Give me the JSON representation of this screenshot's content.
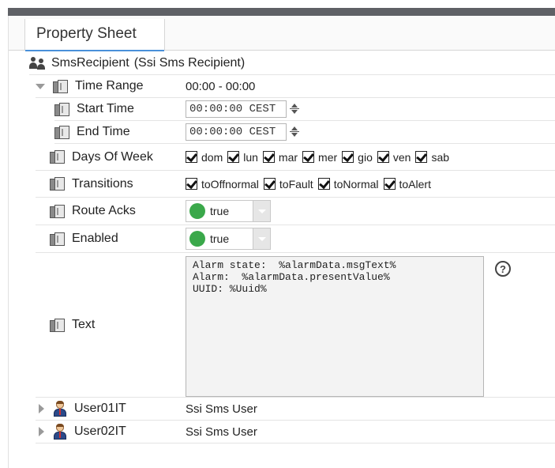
{
  "tab": {
    "label": "Property Sheet"
  },
  "root": {
    "name": "SmsRecipient",
    "type": "(Ssi Sms Recipient)"
  },
  "time_range": {
    "label": "Time Range",
    "value": "00:00 - 00:00",
    "start": {
      "label": "Start Time",
      "value": "00:00:00 CEST"
    },
    "end": {
      "label": "End Time",
      "value": "00:00:00 CEST"
    }
  },
  "days_of_week": {
    "label": "Days Of Week",
    "days": [
      "dom",
      "lun",
      "mar",
      "mer",
      "gio",
      "ven",
      "sab"
    ],
    "checked": [
      true,
      true,
      true,
      true,
      true,
      true,
      true
    ]
  },
  "transitions": {
    "label": "Transitions",
    "options": [
      "toOffnormal",
      "toFault",
      "toNormal",
      "toAlert"
    ],
    "checked": [
      true,
      true,
      true,
      true
    ]
  },
  "route_acks": {
    "label": "Route Acks",
    "value": "true",
    "status_color": "#3aa84a"
  },
  "enabled": {
    "label": "Enabled",
    "value": "true",
    "status_color": "#3aa84a"
  },
  "text": {
    "label": "Text",
    "value": "Alarm state:  %alarmData.msgText%\nAlarm:  %alarmData.presentValue%\nUUID: %Uuid%",
    "help_glyph": "?"
  },
  "users": [
    {
      "name": "User01IT",
      "type": "Ssi Sms User"
    },
    {
      "name": "User02IT",
      "type": "Ssi Sms User"
    }
  ],
  "colors": {
    "accent": "#4a90d9",
    "topbar": "#5f6166"
  }
}
